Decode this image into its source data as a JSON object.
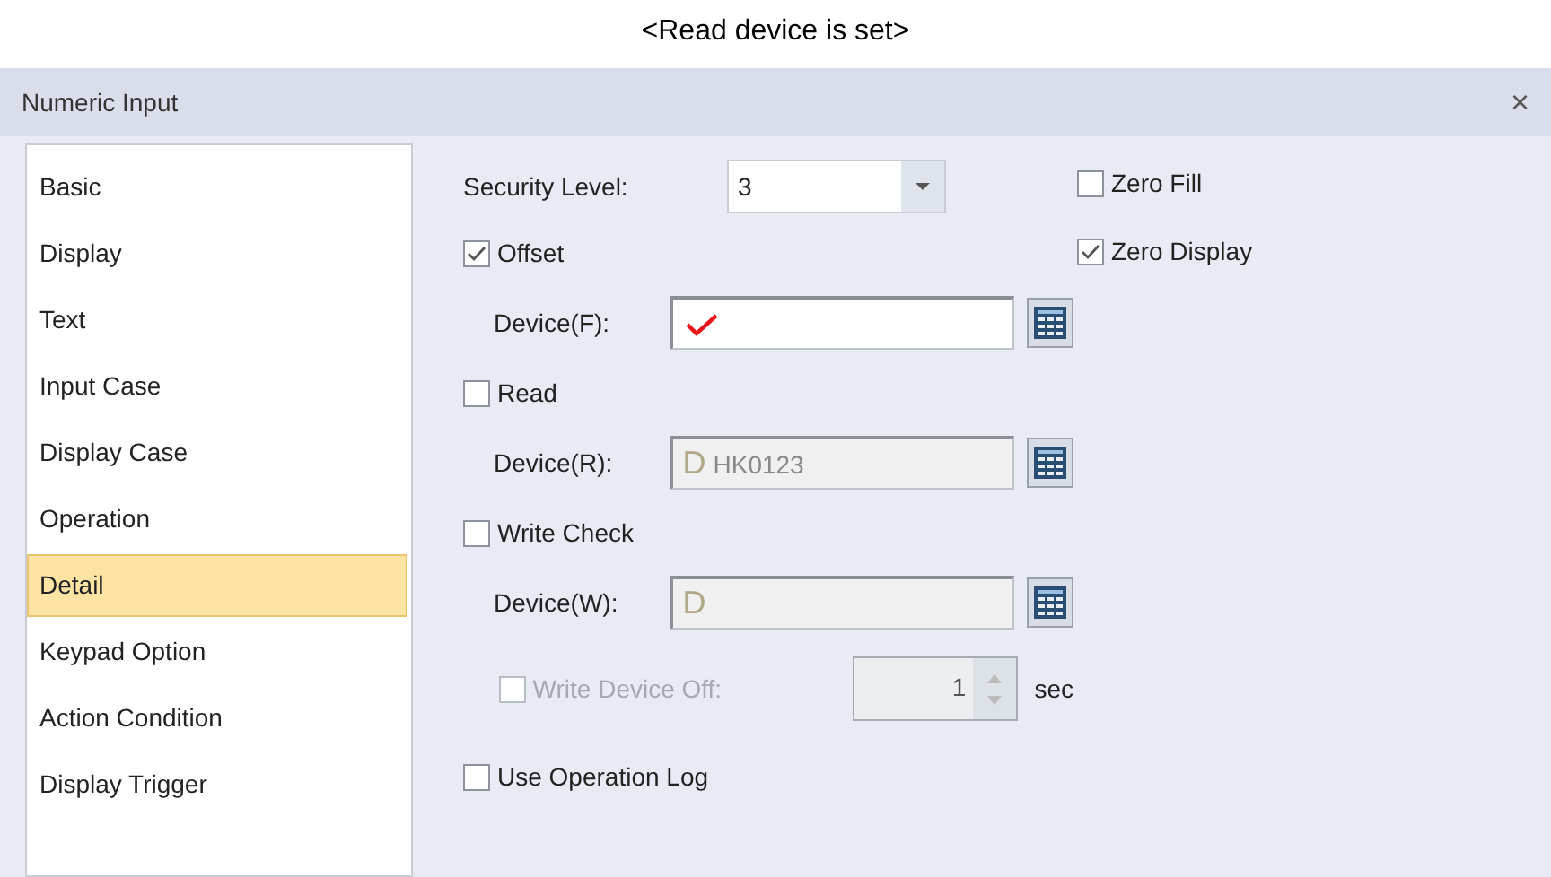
{
  "caption": "<Read device is set>",
  "window": {
    "title": "Numeric Input",
    "close": "×"
  },
  "sidebar": {
    "items": [
      {
        "label": "Basic",
        "selected": false
      },
      {
        "label": "Display",
        "selected": false
      },
      {
        "label": "Text",
        "selected": false
      },
      {
        "label": "Input Case",
        "selected": false
      },
      {
        "label": "Display Case",
        "selected": false
      },
      {
        "label": "Operation",
        "selected": false
      },
      {
        "label": "Detail",
        "selected": true
      },
      {
        "label": "Keypad Option",
        "selected": false
      },
      {
        "label": "Action Condition",
        "selected": false
      },
      {
        "label": "Display Trigger",
        "selected": false
      }
    ]
  },
  "security_level": {
    "label": "Security Level:",
    "value": "3"
  },
  "side_options": [
    {
      "label": "Zero Fill",
      "checked": false
    },
    {
      "label": "Zero Display",
      "checked": true
    }
  ],
  "rows": [
    {
      "kind": "checkbox",
      "label": "Offset",
      "checked": true,
      "disabled": false
    },
    {
      "kind": "device",
      "label": "Device(F):",
      "prefix": "",
      "value": "",
      "disabled": false,
      "marked": true
    },
    {
      "kind": "checkbox",
      "label": "Read",
      "checked": false,
      "disabled": false
    },
    {
      "kind": "device",
      "label": "Device(R):",
      "prefix": "D",
      "value": "HK0123",
      "disabled": true,
      "marked": false
    },
    {
      "kind": "checkbox",
      "label": "Write Check",
      "checked": false,
      "disabled": false
    },
    {
      "kind": "device",
      "label": "Device(W):",
      "prefix": "D",
      "value": "",
      "disabled": true,
      "marked": false
    },
    {
      "kind": "timer",
      "label": "Write Device Off:",
      "checked": false,
      "disabled": true,
      "value": "1",
      "unit": "sec"
    },
    {
      "kind": "checkbox",
      "label": "Use Operation Log",
      "checked": false,
      "disabled": false
    }
  ]
}
